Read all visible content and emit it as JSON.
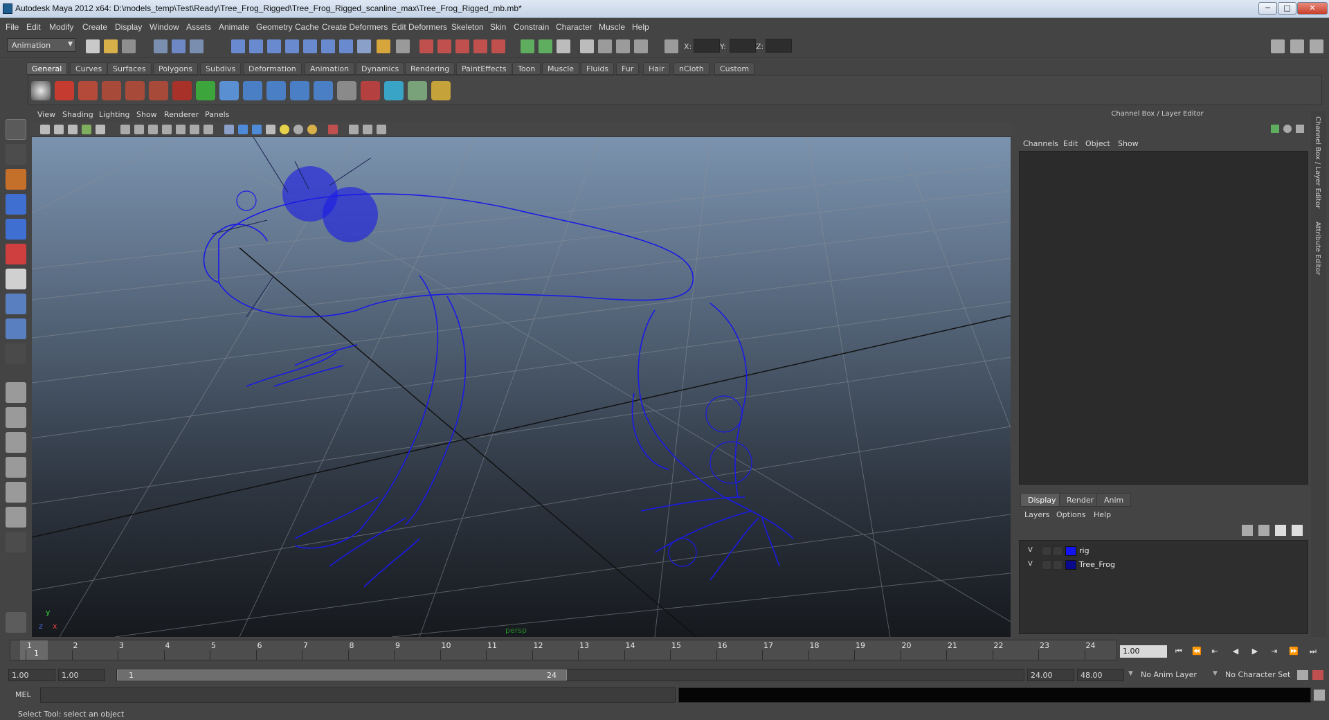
{
  "window": {
    "title": "Autodesk Maya 2012 x64: D:\\models_temp\\Test\\Ready\\Tree_Frog_Rigged\\Tree_Frog_Rigged_scanline_max\\Tree_Frog_Rigged_mb.mb*",
    "minimize": "─",
    "maximize": "□",
    "close": "✕"
  },
  "menubar": [
    "File",
    "Edit",
    "Modify",
    "Create",
    "Display",
    "Window",
    "Assets",
    "Animate",
    "Geometry Cache",
    "Create Deformers",
    "Edit Deformers",
    "Skeleton",
    "Skin",
    "Constrain",
    "Character",
    "Muscle",
    "Help"
  ],
  "statusline": {
    "mode": "Animation",
    "x_label": "X:",
    "y_label": "Y:",
    "z_label": "Z:"
  },
  "shelf": {
    "tabs": [
      "General",
      "Curves",
      "Surfaces",
      "Polygons",
      "Subdivs",
      "Deformation",
      "Animation",
      "Dynamics",
      "Rendering",
      "PaintEffects",
      "Toon",
      "Muscle",
      "Fluids",
      "Fur",
      "Hair",
      "nCloth",
      "Custom"
    ],
    "active_tab": "General"
  },
  "panel_menu": [
    "View",
    "Shading",
    "Lighting",
    "Show",
    "Renderer",
    "Panels"
  ],
  "viewport": {
    "camera_label": "persp",
    "axis_y": "y",
    "axis_x": "x",
    "axis_z": "z",
    "wire_color": "#1a1ae6"
  },
  "channel_box": {
    "title": "Channel Box / Layer Editor",
    "menu": [
      "Channels",
      "Edit",
      "Object",
      "Show"
    ]
  },
  "layer_editor": {
    "tabs": [
      "Display",
      "Render",
      "Anim"
    ],
    "active_tab": "Display",
    "menu": [
      "Layers",
      "Options",
      "Help"
    ],
    "layers": [
      {
        "visible": "V",
        "name": "rig",
        "color": "#1414f0"
      },
      {
        "visible": "V",
        "name": "Tree_Frog",
        "color": "#0a0a8c"
      }
    ]
  },
  "side_tabs": [
    "Channel Box / Layer Editor",
    "Attribute Editor"
  ],
  "time_slider": {
    "ticks": [
      "1",
      "2",
      "3",
      "4",
      "5",
      "6",
      "7",
      "8",
      "9",
      "10",
      "11",
      "12",
      "13",
      "14",
      "15",
      "16",
      "17",
      "18",
      "19",
      "20",
      "21",
      "22",
      "23",
      "24"
    ],
    "current_frame_marker": "1",
    "current_frame": "1.00"
  },
  "playback": [
    "⏮",
    "⏪",
    "⇤",
    "◀",
    "▶",
    "⇥",
    "⏩",
    "⏭"
  ],
  "range_slider": {
    "start_time": "1.00",
    "playback_start": "1.00",
    "range_start_label": "1",
    "range_end_label": "24",
    "playback_end": "24.00",
    "end_time": "48.00",
    "anim_layer": "No Anim Layer",
    "character_set": "No Character Set"
  },
  "command_line": {
    "label": "MEL"
  },
  "help_line": "Select Tool: select an object"
}
